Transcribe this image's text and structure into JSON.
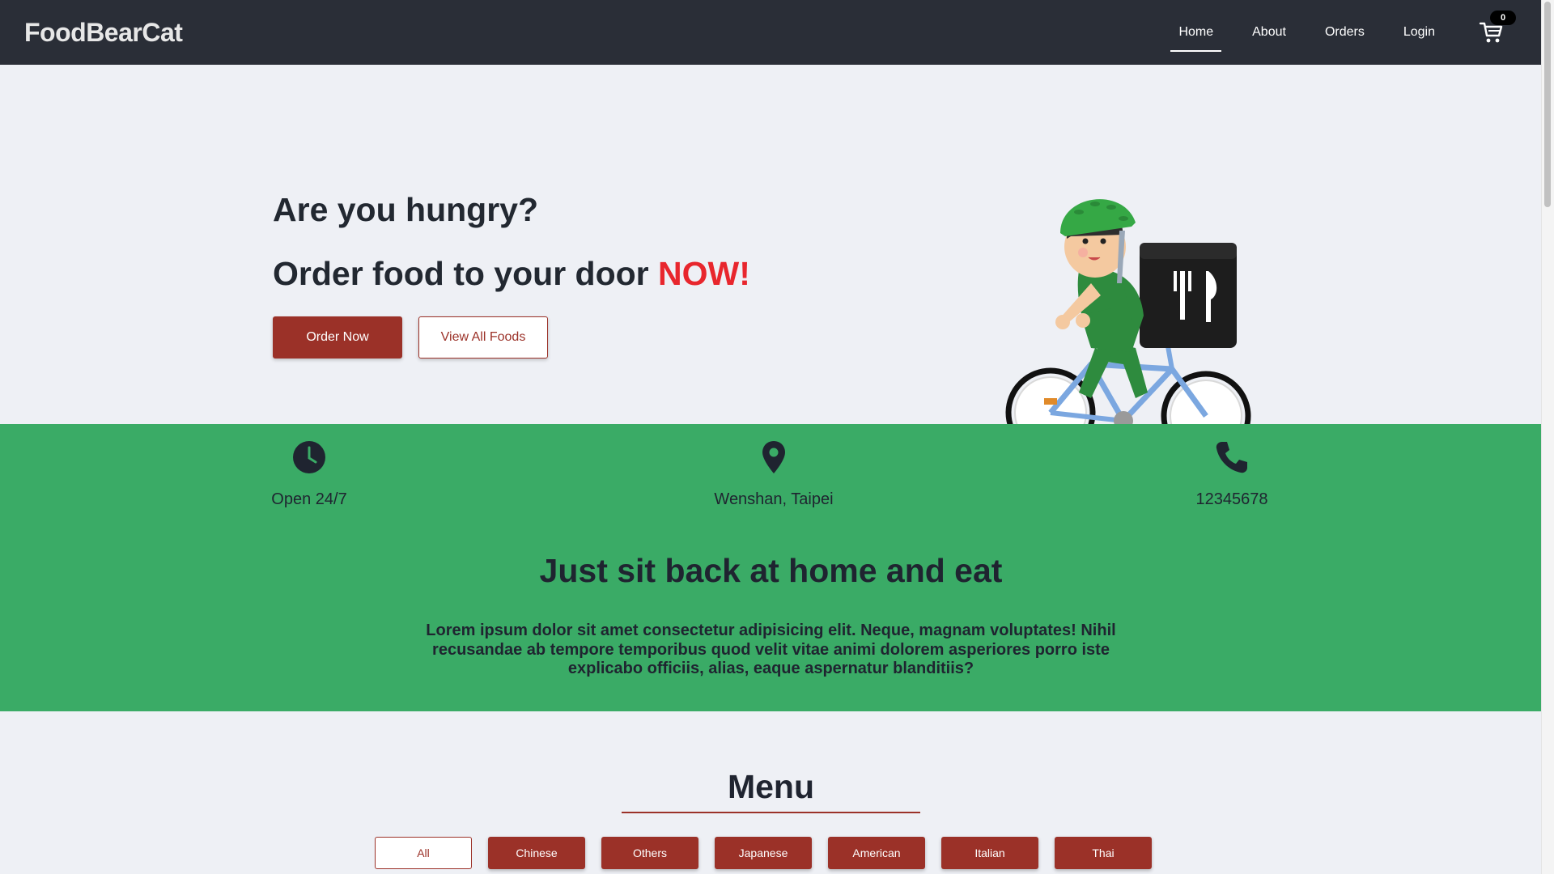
{
  "navbar": {
    "brand": "FoodBearCat",
    "links": [
      {
        "label": "Home",
        "active": true
      },
      {
        "label": "About",
        "active": false
      },
      {
        "label": "Orders",
        "active": false
      },
      {
        "label": "Login",
        "active": false
      }
    ],
    "cart_count": "0",
    "cart_icon": "cart-icon"
  },
  "hero": {
    "headline": "Are you hungry?",
    "subheadline": "Order food to your door ",
    "highlight": "NOW!",
    "order_button": "Order Now",
    "view_button": "View All Foods",
    "illustration": "delivery-cyclist-illustration"
  },
  "info": {
    "items": [
      {
        "icon": "clock-icon",
        "label": "Open 24/7"
      },
      {
        "icon": "map-pin-icon",
        "label": "Wenshan, Taipei"
      },
      {
        "icon": "phone-icon",
        "label": "12345678"
      }
    ],
    "heading": "Just sit back at home and eat",
    "text": "Lorem ipsum dolor sit amet consectetur adipisicing elit. Neque, magnam voluptates! Nihil recusandae ab tempore temporibus quod velit vitae animi dolorem asperiores porro iste explicabo officiis, alias, eaque aspernatur blanditiis?"
  },
  "menu": {
    "title": "Menu",
    "filters": [
      {
        "label": "All",
        "active": true
      },
      {
        "label": "Chinese",
        "active": false
      },
      {
        "label": "Others",
        "active": false
      },
      {
        "label": "Japanese",
        "active": false
      },
      {
        "label": "American",
        "active": false
      },
      {
        "label": "Italian",
        "active": false
      },
      {
        "label": "Thai",
        "active": false
      }
    ]
  },
  "colors": {
    "navbar": "#2a2e37",
    "accent_red": "#9b3128",
    "now_red": "#e8262d",
    "info_green": "#3aab66",
    "page_bg": "#eef0f5"
  }
}
